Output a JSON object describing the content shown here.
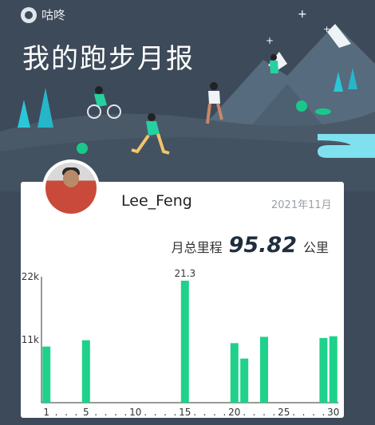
{
  "app": {
    "logo_text": "咕咚"
  },
  "title": "我的跑步月报",
  "user": {
    "name": "Lee_Feng"
  },
  "month": "2021年11月",
  "total": {
    "label": "月总里程",
    "value": "95.82",
    "unit": "公里"
  },
  "colors": {
    "bar": "#1fd18b",
    "bar_dark": "#13b978",
    "bg": "#3d4a5a"
  },
  "chart_data": {
    "type": "bar",
    "x": [
      1,
      2,
      3,
      4,
      5,
      6,
      7,
      8,
      9,
      10,
      11,
      12,
      13,
      14,
      15,
      16,
      17,
      18,
      19,
      20,
      21,
      22,
      23,
      24,
      25,
      26,
      27,
      28,
      29,
      30
    ],
    "values": [
      9.8,
      0,
      0,
      0,
      10.9,
      0,
      0,
      0,
      0,
      0,
      0,
      0,
      0,
      0,
      21.3,
      0,
      0,
      0,
      0,
      10.4,
      7.7,
      0,
      11.5,
      0,
      0,
      0,
      0,
      0,
      11.3,
      11.6
    ],
    "ylim": [
      0,
      22
    ],
    "ytick_labels": [
      "11k",
      "22k"
    ],
    "xtick_labels": [
      "1",
      "5",
      "10",
      "15",
      "20",
      "25",
      "30"
    ],
    "peak_label": "21.3"
  }
}
